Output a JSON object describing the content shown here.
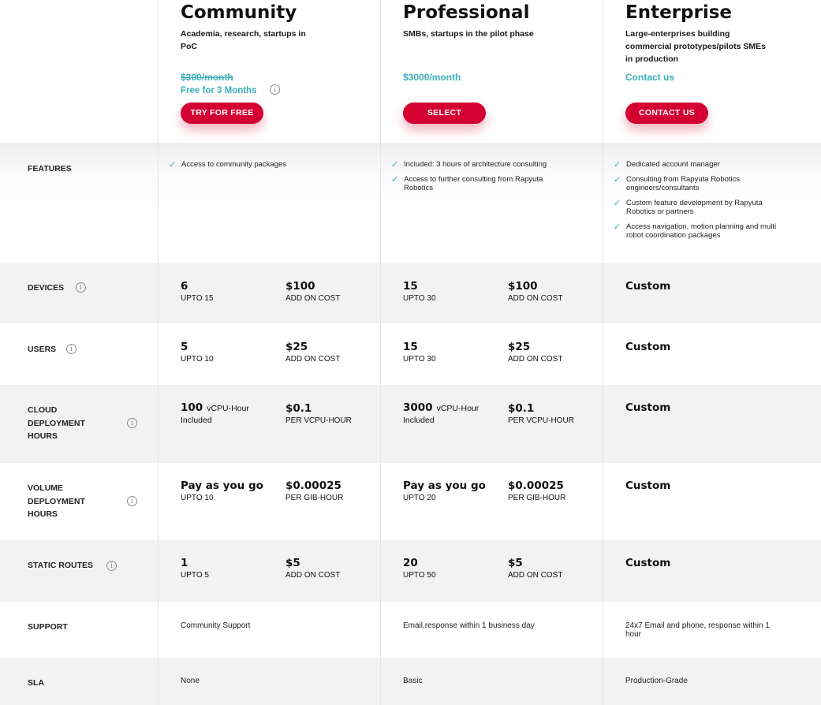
{
  "plans": [
    {
      "title": "Community",
      "desc": "Academia, research, startups in PoC",
      "price_strike": "$300/month",
      "price_note": "Free for 3 Months",
      "cta": "TRY FOR FREE"
    },
    {
      "title": "Professional",
      "desc": "SMBs, startups in the pilot phase",
      "price": "$3000/month",
      "cta": "SELECT"
    },
    {
      "title": "Enterprise",
      "desc": "Large-enterprises building commercial prototypes/pilots SMEs in production",
      "price": "Contact us",
      "cta": "CONTACT US"
    }
  ],
  "features": {
    "label": "FEATURES",
    "community": [
      "Access to community packages"
    ],
    "professional": [
      "Included: 3 hours of architecture consulting",
      "Access to further consulting from Rapyuta Robotics"
    ],
    "enterprise": [
      "Dedicated account manager",
      "Consulting from Rapyuta Robotics engineers/consultants",
      "Custom feature development by Rapyuta Robotics or partners",
      "Access navigation, motion planning and multi robot coordination packages"
    ]
  },
  "rows": {
    "devices": {
      "label": "DEVICES",
      "community": {
        "main": "6",
        "sub": "UPTO 15",
        "add": "$100",
        "add_sub": "ADD ON COST"
      },
      "professional": {
        "main": "15",
        "sub": "UPTO 30",
        "add": "$100",
        "add_sub": "ADD ON COST"
      },
      "enterprise": "Custom"
    },
    "users": {
      "label": "USERS",
      "community": {
        "main": "5",
        "sub": "UPTO 10",
        "add": "$25",
        "add_sub": "ADD ON COST"
      },
      "professional": {
        "main": "15",
        "sub": "UPTO 30",
        "add": "$25",
        "add_sub": "ADD ON COST"
      },
      "enterprise": "Custom"
    },
    "cloud": {
      "label": "CLOUD DEPLOYMENT HOURS",
      "community": {
        "main": "100",
        "unit": "vCPU-Hour",
        "sub": "Included",
        "add": "$0.1",
        "add_sub": "PER VCPU-HOUR"
      },
      "professional": {
        "main": "3000",
        "unit": "vCPU-Hour",
        "sub": "Included",
        "add": "$0.1",
        "add_sub": "PER VCPU-HOUR"
      },
      "enterprise": "Custom"
    },
    "volume": {
      "label": "VOLUME DEPLOYMENT HOURS",
      "community": {
        "main": "Pay as you go",
        "sub": "UPTO 10",
        "add": "$0.00025",
        "add_sub": "PER GIB-HOUR"
      },
      "professional": {
        "main": "Pay as you go",
        "sub": "UPTO 20",
        "add": "$0.00025",
        "add_sub": "PER GIB-HOUR"
      },
      "enterprise": "Custom"
    },
    "routes": {
      "label": "STATIC ROUTES",
      "community": {
        "main": "1",
        "sub": "UPTO 5",
        "add": "$5",
        "add_sub": "ADD ON COST"
      },
      "professional": {
        "main": "20",
        "sub": "UPTO 50",
        "add": "$5",
        "add_sub": "ADD ON COST"
      },
      "enterprise": "Custom"
    },
    "support": {
      "label": "SUPPORT",
      "community": "Community Support",
      "professional": "Email,response within 1 business day",
      "enterprise": "24x7 Email and phone, response within 1 hour"
    },
    "sla": {
      "label": "SLA",
      "community": "None",
      "professional": "Basic",
      "enterprise": "Production-Grade"
    }
  },
  "icons": {
    "info": "i",
    "check": "✓"
  },
  "colors": {
    "accent": "#d50032",
    "teal": "#3aaeb8",
    "row_shade": "#f2f2f2"
  }
}
